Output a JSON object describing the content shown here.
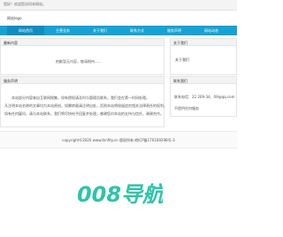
{
  "topbar": {
    "text": "您好！欢迎您访问本网站。"
  },
  "site": {
    "logo_text": "网站logo"
  },
  "nav": {
    "items": [
      {
        "label": "网站首页",
        "active": true
      },
      {
        "label": "主营业务"
      },
      {
        "label": "关于我们"
      },
      {
        "label": "联系方式"
      },
      {
        "label": "服务声明"
      },
      {
        "label": "网站动态"
      }
    ]
  },
  "main_box": {
    "title": "最新内容",
    "empty_message": "抱歉暂无内容，敬请期待......"
  },
  "side_box": {
    "title": "关于我们",
    "link": "关于我们"
  },
  "intro_box": {
    "title": "服务声明",
    "lines": [
      "本站部分内容来自互联网搜集，如有侵权请及时与管理员联系，我们会在第一时间处理。",
      "凡注明本站名称的文章均为本站原创，如需转载请注明出处，否则本站将保留追究相关法律责任的权利，",
      "如有任何疑问，请与本站联系，我们将尽快给予回复并处理，感谢您对本站的支持与信任，谢谢合作。"
    ]
  },
  "contact_box": {
    "title": "联系我们",
    "phone_line": "联系电话：22 209-3d、09@qq.com",
    "note": "不提供任何服务"
  },
  "footer": {
    "text": "copyright©2020 www.tknfity.cn 版权所有  皖ICP备17010929B号-3"
  },
  "watermark": {
    "text": "008导航",
    "color": "#2ec4a9"
  }
}
